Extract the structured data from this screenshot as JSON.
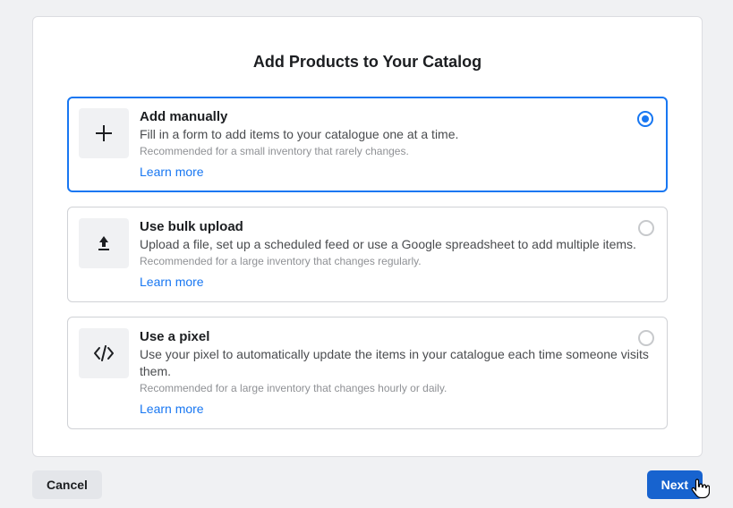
{
  "title": "Add Products to Your Catalog",
  "options": [
    {
      "title": "Add manually",
      "desc": "Fill in a form to add items to your catalogue one at a time.",
      "rec": "Recommended for a small inventory that rarely changes.",
      "learn": "Learn more",
      "selected": true
    },
    {
      "title": "Use bulk upload",
      "desc": "Upload a file, set up a scheduled feed or use a Google spreadsheet to add multiple items.",
      "rec": "Recommended for a large inventory that changes regularly.",
      "learn": "Learn more",
      "selected": false
    },
    {
      "title": "Use a pixel",
      "desc": "Use your pixel to automatically update the items in your catalogue each time someone visits them.",
      "rec": "Recommended for a large inventory that changes hourly or daily.",
      "learn": "Learn more",
      "selected": false
    }
  ],
  "actions": {
    "cancel": "Cancel",
    "next": "Next"
  }
}
